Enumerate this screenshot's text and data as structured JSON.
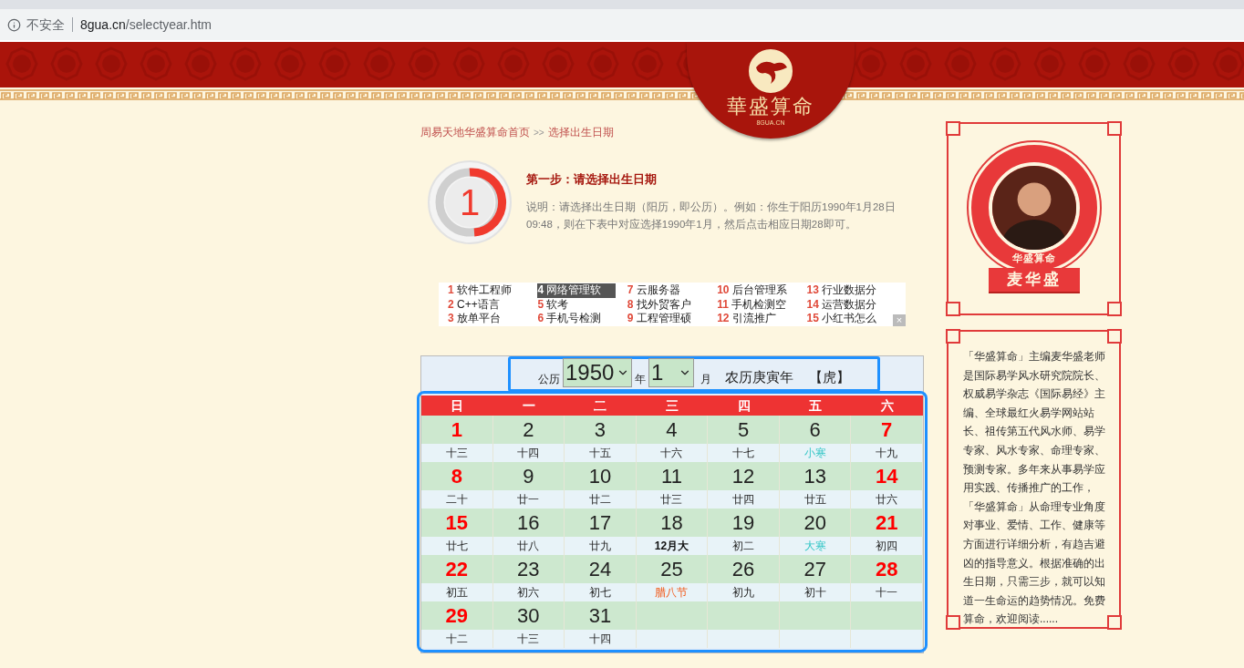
{
  "browser": {
    "security_label": "不安全",
    "url_host": "8gua.cn",
    "url_path": "/selectyear.htm"
  },
  "header": {
    "logo_title": "華盛算命",
    "logo_domain": "8GUA.CN"
  },
  "breadcrumb": {
    "home": "周易天地华盛算命首页",
    "separator": ">>",
    "current": "选择出生日期"
  },
  "step": {
    "number": "1",
    "title": "第一步：请选择出生日期",
    "description": "说明：请选择出生日期（阳历，即公历）。例如：你生于阳历1990年1月28日09:48，则在下表中对应选择1990年1月，然后点击相应日期28即可。"
  },
  "ad_links": [
    {
      "number": "1",
      "text": "软件工程师",
      "highlighted": false
    },
    {
      "number": "4",
      "text": "网络管理软",
      "highlighted": true
    },
    {
      "number": "7",
      "text": "云服务器",
      "highlighted": false
    },
    {
      "number": "10",
      "text": "后台管理系",
      "highlighted": false
    },
    {
      "number": "13",
      "text": "行业数据分",
      "highlighted": false
    },
    {
      "number": "2",
      "text": "C++语言",
      "highlighted": false
    },
    {
      "number": "5",
      "text": "软考",
      "highlighted": false
    },
    {
      "number": "8",
      "text": "找外贸客户",
      "highlighted": false
    },
    {
      "number": "11",
      "text": "手机检测空",
      "highlighted": false
    },
    {
      "number": "14",
      "text": "运营数据分",
      "highlighted": false
    },
    {
      "number": "3",
      "text": "放单平台",
      "highlighted": false
    },
    {
      "number": "6",
      "text": "手机号检测",
      "highlighted": false
    },
    {
      "number": "9",
      "text": "工程管理硕",
      "highlighted": false
    },
    {
      "number": "12",
      "text": "引流推广",
      "highlighted": false
    },
    {
      "number": "15",
      "text": "小红书怎么",
      "highlighted": false
    }
  ],
  "ad_close": "×",
  "calendar": {
    "calendar_label": "公历",
    "year": "1950",
    "year_unit": "年",
    "month": "1",
    "month_unit": "月",
    "lunar_year": "农历庚寅年",
    "zodiac": "【虎】",
    "weekdays": [
      "日",
      "一",
      "二",
      "三",
      "四",
      "五",
      "六"
    ],
    "weeks": [
      [
        {
          "day": "1",
          "lunar": "十三",
          "weekend": true,
          "kind": "plain"
        },
        {
          "day": "2",
          "lunar": "十四",
          "weekend": false,
          "kind": "plain"
        },
        {
          "day": "3",
          "lunar": "十五",
          "weekend": false,
          "kind": "plain"
        },
        {
          "day": "4",
          "lunar": "十六",
          "weekend": false,
          "kind": "plain"
        },
        {
          "day": "5",
          "lunar": "十七",
          "weekend": false,
          "kind": "plain"
        },
        {
          "day": "6",
          "lunar": "小寒",
          "weekend": false,
          "kind": "solar_term"
        },
        {
          "day": "7",
          "lunar": "十九",
          "weekend": true,
          "kind": "plain"
        }
      ],
      [
        {
          "day": "8",
          "lunar": "二十",
          "weekend": true,
          "kind": "plain"
        },
        {
          "day": "9",
          "lunar": "廿一",
          "weekend": false,
          "kind": "plain"
        },
        {
          "day": "10",
          "lunar": "廿二",
          "weekend": false,
          "kind": "plain"
        },
        {
          "day": "11",
          "lunar": "廿三",
          "weekend": false,
          "kind": "plain"
        },
        {
          "day": "12",
          "lunar": "廿四",
          "weekend": false,
          "kind": "plain"
        },
        {
          "day": "13",
          "lunar": "廿五",
          "weekend": false,
          "kind": "plain"
        },
        {
          "day": "14",
          "lunar": "廿六",
          "weekend": true,
          "kind": "plain"
        }
      ],
      [
        {
          "day": "15",
          "lunar": "廿七",
          "weekend": true,
          "kind": "plain"
        },
        {
          "day": "16",
          "lunar": "廿八",
          "weekend": false,
          "kind": "plain"
        },
        {
          "day": "17",
          "lunar": "廿九",
          "weekend": false,
          "kind": "plain"
        },
        {
          "day": "18",
          "lunar": "12月大",
          "weekend": false,
          "kind": "month_start"
        },
        {
          "day": "19",
          "lunar": "初二",
          "weekend": false,
          "kind": "plain"
        },
        {
          "day": "20",
          "lunar": "大寒",
          "weekend": false,
          "kind": "solar_term"
        },
        {
          "day": "21",
          "lunar": "初四",
          "weekend": true,
          "kind": "plain"
        }
      ],
      [
        {
          "day": "22",
          "lunar": "初五",
          "weekend": true,
          "kind": "plain"
        },
        {
          "day": "23",
          "lunar": "初六",
          "weekend": false,
          "kind": "plain"
        },
        {
          "day": "24",
          "lunar": "初七",
          "weekend": false,
          "kind": "plain"
        },
        {
          "day": "25",
          "lunar": "腊八节",
          "weekend": false,
          "kind": "festival"
        },
        {
          "day": "26",
          "lunar": "初九",
          "weekend": false,
          "kind": "plain"
        },
        {
          "day": "27",
          "lunar": "初十",
          "weekend": false,
          "kind": "plain"
        },
        {
          "day": "28",
          "lunar": "十一",
          "weekend": true,
          "kind": "plain"
        }
      ],
      [
        {
          "day": "29",
          "lunar": "十二",
          "weekend": true,
          "kind": "plain"
        },
        {
          "day": "30",
          "lunar": "十三",
          "weekend": false,
          "kind": "plain"
        },
        {
          "day": "31",
          "lunar": "十四",
          "weekend": false,
          "kind": "plain"
        }
      ]
    ]
  },
  "profile": {
    "seal_text": "华盛算命",
    "name": "麦华盛"
  },
  "bio": "「华盛算命」主编麦华盛老师是国际易学风水研究院院长、权威易学杂志《国际易经》主编、全球最红火易学网站站长、祖传第五代风水师、易学专家、风水专家、命理专家、预测专家。多年来从事易学应用实践、传播推广的工作，「华盛算命」从命理专业角度对事业、爱情、工作、健康等方面进行详细分析，有趋吉避凶的指导意义。根据准确的出生日期，只需三步，就可以知道一生命运的趋势情况。免费算命，欢迎阅读......"
}
